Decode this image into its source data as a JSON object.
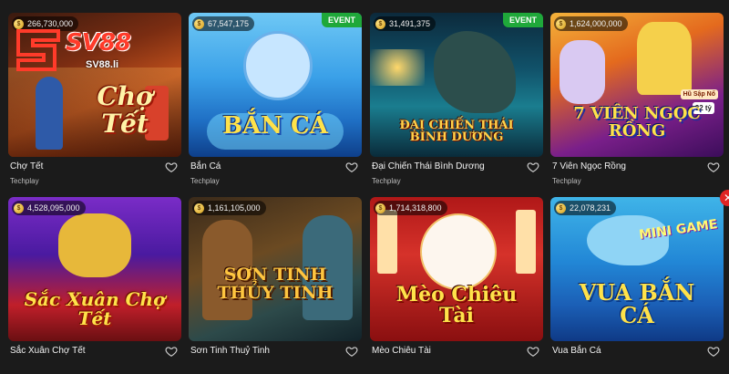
{
  "brand": {
    "logo_text": "SV88",
    "logo_url": "SV88.li"
  },
  "event_label": "EVENT",
  "games": [
    {
      "name": "Chợ Tết",
      "provider": "Techplay",
      "jackpot": "266,730,000",
      "art_title": "Chợ Tết",
      "event": false
    },
    {
      "name": "Bắn Cá",
      "provider": "Techplay",
      "jackpot": "67,547,175",
      "art_title": "BẮN CÁ",
      "event": true
    },
    {
      "name": "Đại Chiến Thái Bình Dương",
      "provider": "Techplay",
      "jackpot": "31,491,375",
      "art_title": "ĐẠI CHIẾN THÁI BÌNH DƯƠNG",
      "event": true
    },
    {
      "name": "7 Viên Ngọc Rồng",
      "provider": "Techplay",
      "jackpot": "1,624,000,000",
      "art_title": "7 VIÊN NGỌC RỒNG",
      "art_tags": [
        "Hũ Sập Nổ",
        "32 tỷ"
      ],
      "event": false
    },
    {
      "name": "Sắc Xuân Chợ Tết",
      "provider": "",
      "jackpot": "4,528,095,000",
      "art_title": "Sắc Xuân Chợ Tết",
      "event": false
    },
    {
      "name": "Sơn Tinh Thuỷ Tinh",
      "provider": "",
      "jackpot": "1,161,105,000",
      "art_title": "SƠN TINH THỦY TINH",
      "event": false
    },
    {
      "name": "Mèo Chiêu Tài",
      "provider": "",
      "jackpot": "1,714,318,800",
      "art_title": "Mèo Chiêu Tài",
      "event": false
    },
    {
      "name": "Vua Bắn Cá",
      "provider": "",
      "jackpot": "22,078,231",
      "art_title": "VUA BẮN CÁ",
      "art_badge": "MINI GAME",
      "event": false
    }
  ],
  "icons": {
    "favorite": "heart-outline-icon",
    "coin": "coin-icon",
    "close": "close-icon"
  },
  "colors": {
    "background": "#1b1b1b",
    "event_badge": "#1fa83a",
    "logo_red": "#ff3b2a"
  }
}
